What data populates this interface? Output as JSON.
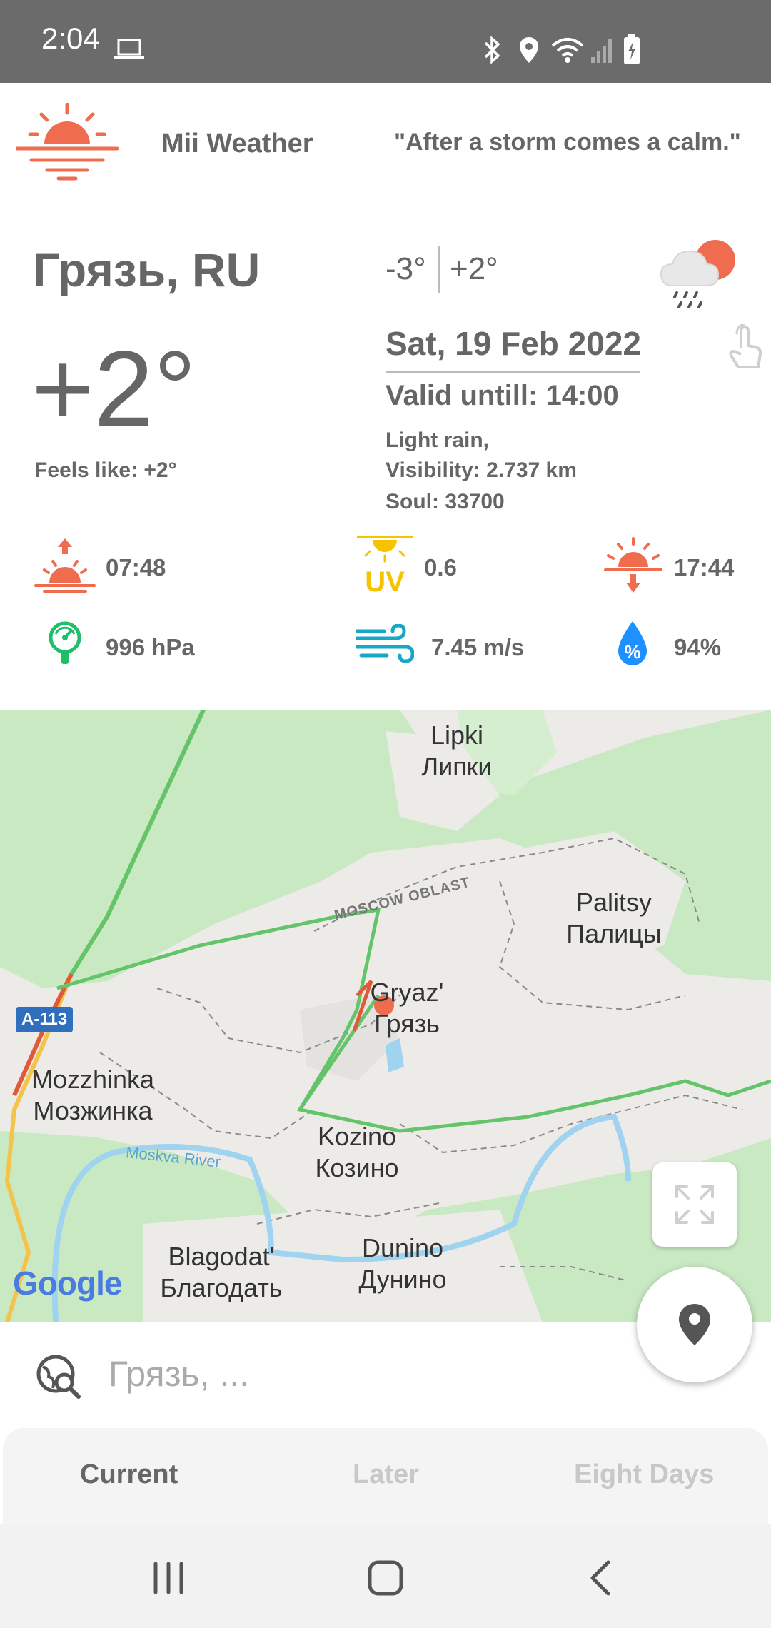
{
  "status_bar": {
    "time": "2:04"
  },
  "app": {
    "title": "Mii Weather",
    "quote": "\"After a storm comes a calm.\""
  },
  "weather": {
    "city": "Грязь, RU",
    "temperature": "+2°",
    "feels_like": "Feels like: +2°",
    "temp_min": "-3°",
    "temp_max": "+2°",
    "date": "Sat, 19 Feb 2022",
    "valid_until": "Valid untill: 14:00",
    "description": "Light rain,",
    "visibility": "Visibility: 2.737 km",
    "soul": "Soul: 33700"
  },
  "metrics": {
    "sunrise": "07:48",
    "uv_index": "0.6",
    "sunset": "17:44",
    "pressure": "996 hPa",
    "wind": "7.45 m/s",
    "humidity": "94%"
  },
  "map": {
    "labels": {
      "lipki_en": "Lipki",
      "lipki_ru": "Липки",
      "palitsy_en": "Palitsy",
      "palitsy_ru": "Палицы",
      "gryaz_en": "Gryaz'",
      "gryaz_ru": "Грязь",
      "mozzhinka_en": "Mozzhinka",
      "mozzhinka_ru": "Мозжинка",
      "kozino_en": "Kozino",
      "kozino_ru": "Козино",
      "blagodat_en": "Blagodat'",
      "blagodat_ru": "Благодать",
      "dunino_en": "Dunino",
      "dunino_ru": "Дунино",
      "oblast": "MOSCOW OBLAST",
      "river": "Moskva River",
      "road": "A-113"
    },
    "google_logo": "Google"
  },
  "search": {
    "placeholder": "Грязь, ..."
  },
  "tabs": [
    {
      "label": "Current",
      "active": true
    },
    {
      "label": "Later",
      "active": false
    },
    {
      "label": "Eight Days",
      "active": false
    }
  ],
  "colors": {
    "accent_orange": "#ef6c4f",
    "uv_yellow": "#f5c400",
    "pressure_green": "#1fbf6a",
    "wind_teal": "#17a7c9",
    "humidity_blue": "#1e90ff",
    "map_green": "#c9e9c3"
  }
}
